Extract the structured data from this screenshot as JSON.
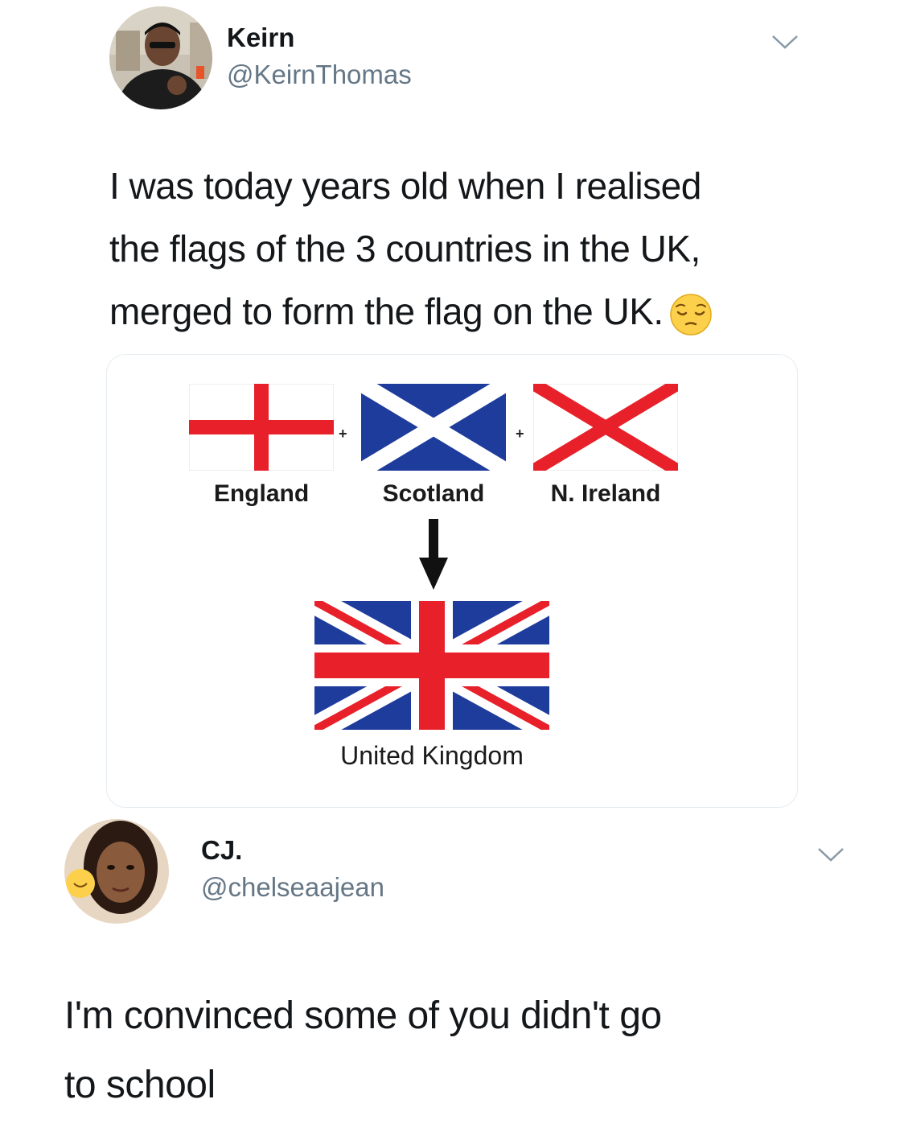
{
  "tweets": [
    {
      "display_name": "Keirn",
      "handle": "@KeirnThomas",
      "text_lines": [
        "I was today years old when I realised",
        "the flags of the 3 countries in the UK,",
        "merged to form the flag on the UK."
      ],
      "emoji": "pensive-face",
      "media": {
        "flags": [
          {
            "label": "England",
            "icon": "england-flag"
          },
          {
            "label": "Scotland",
            "icon": "scotland-flag"
          },
          {
            "label": "N. Ireland",
            "icon": "northern-ireland-flag"
          }
        ],
        "plus_sign": "+",
        "result_label": "United Kingdom",
        "colors": {
          "red": "#e8202a",
          "blue": "#1e3c9c",
          "white": "#ffffff"
        }
      }
    },
    {
      "display_name": "CJ.",
      "handle": "@chelseaajean",
      "text_lines": [
        "I'm convinced some of you didn't go",
        "to school"
      ]
    }
  ]
}
